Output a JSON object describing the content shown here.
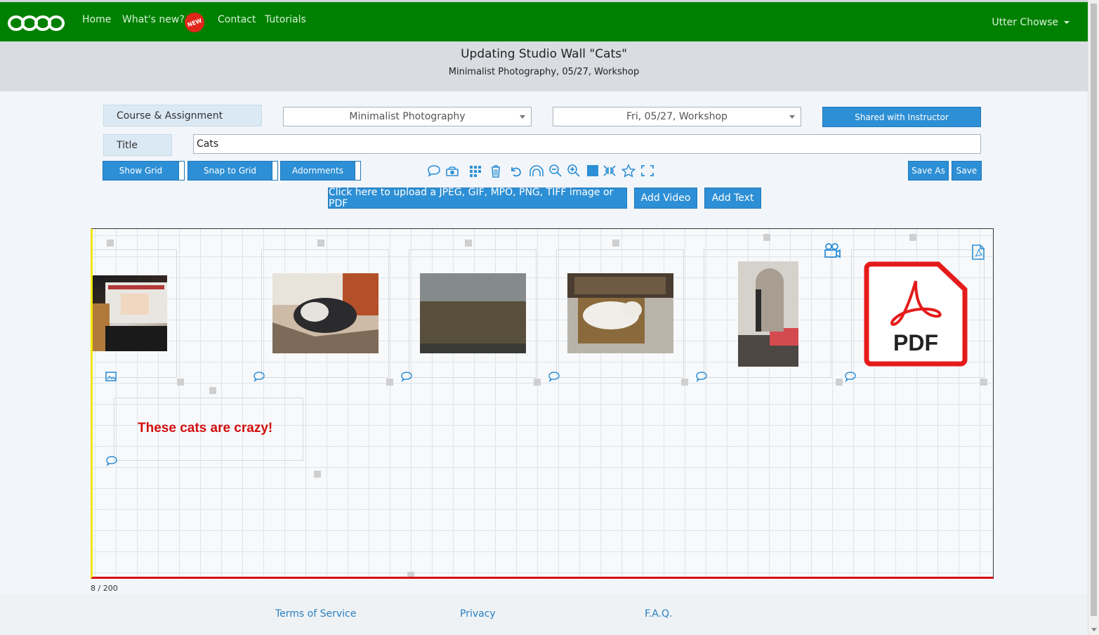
{
  "nav": {
    "logo_icon": "four-rings-logo",
    "home": "Home",
    "whats_new": "What's new?",
    "new_badge": "NEW",
    "contact": "Contact",
    "tutorials": "Tutorials",
    "user": "Utter Chowse"
  },
  "header": {
    "title": "Updating Studio Wall \"Cats\"",
    "subtitle": "Minimalist Photography, 05/27, Workshop"
  },
  "form": {
    "course_label": "Course & Assignment",
    "course_value": "Minimalist Photography",
    "assignment_value": "Fri, 05/27, Workshop",
    "shared_button": "Shared with Instructor",
    "title_label": "Title",
    "title_value": "Cats"
  },
  "toolbar": {
    "show_grid": "Show Grid",
    "snap_to_grid": "Snap to Grid",
    "adornments": "Adornments",
    "save_as": "Save As",
    "save": "Save",
    "icons": [
      "comment-icon",
      "camera-icon",
      "grid-icon",
      "trash-icon",
      "undo-icon",
      "arch-icon",
      "zoom-out-icon",
      "zoom-in-icon",
      "square-icon",
      "compress-icon",
      "star-icon",
      "expand-icon"
    ]
  },
  "upload": {
    "upload_button": "Click here to upload a JPEG, GIF, MPO, PNG, TIFF image or PDF",
    "add_video": "Add Video",
    "add_text": "Add Text"
  },
  "canvas": {
    "text_item": "These cats are crazy!",
    "pdf_label": "PDF",
    "counter": "8 / 200"
  },
  "footer": {
    "terms": "Terms of Service",
    "privacy": "Privacy",
    "faq": "F.A.Q."
  },
  "colors": {
    "nav_green": "#008000",
    "accent_blue": "#2d8fd5",
    "canvas_left_border": "#f2e600",
    "canvas_bottom_border": "#d81010",
    "text_red": "#d10f0f"
  }
}
